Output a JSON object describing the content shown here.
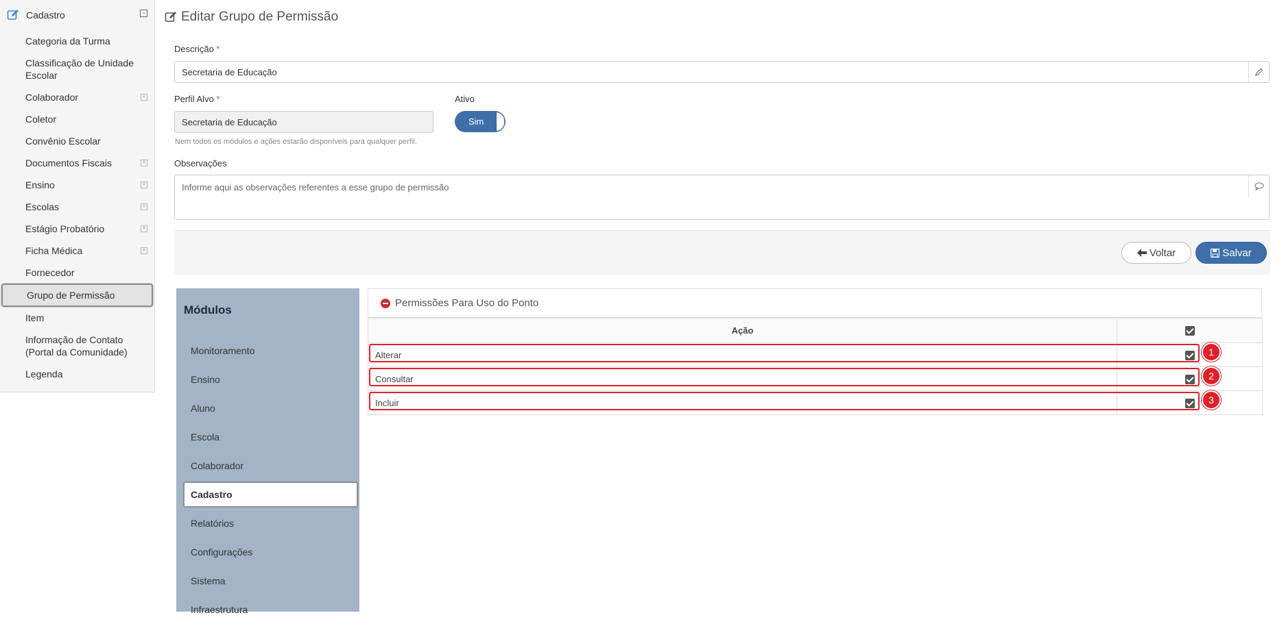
{
  "sidebar": {
    "header": "Cadastro",
    "items": [
      {
        "label": "Categoria da Turma",
        "expandable": false
      },
      {
        "label": "Classificação de Unidade Escolar",
        "expandable": false
      },
      {
        "label": "Colaborador",
        "expandable": true
      },
      {
        "label": "Coletor",
        "expandable": false
      },
      {
        "label": "Convênio Escolar",
        "expandable": false
      },
      {
        "label": "Documentos Fiscais",
        "expandable": true
      },
      {
        "label": "Ensino",
        "expandable": true
      },
      {
        "label": "Escolas",
        "expandable": true
      },
      {
        "label": "Estágio Probatório",
        "expandable": true
      },
      {
        "label": "Ficha Médica",
        "expandable": true
      },
      {
        "label": "Fornecedor",
        "expandable": false
      },
      {
        "label": "Grupo de Permissão",
        "expandable": false,
        "active": true
      },
      {
        "label": "Item",
        "expandable": false
      },
      {
        "label": "Informação de Contato (Portal da Comunidade)",
        "expandable": false
      },
      {
        "label": "Legenda",
        "expandable": false
      }
    ]
  },
  "page": {
    "title": "Editar Grupo de Permissão"
  },
  "form": {
    "descricao_label": "Descrição",
    "descricao_value": "Secretaria de Educação",
    "perfil_label": "Perfil Alvo",
    "perfil_value": "Secretaria de Educação",
    "perfil_hint": "Nem todos os módulos e ações estarão disponíveis para qualquer perfil.",
    "ativo_label": "Ativo",
    "ativo_value": "Sim",
    "obs_label": "Observações",
    "obs_placeholder": "Informe aqui as observações referentes a esse grupo de permissão",
    "required_mark": "*"
  },
  "actions": {
    "back_label": "Voltar",
    "save_label": "Salvar"
  },
  "modules": {
    "title": "Módulos",
    "items": [
      "Monitoramento",
      "Ensino",
      "Aluno",
      "Escola",
      "Colaborador",
      "Cadastro",
      "Relatórios",
      "Configurações",
      "Sistema",
      "Infraestrutura"
    ],
    "active": "Cadastro"
  },
  "permissions": {
    "title": "Permissões Para Uso do Ponto",
    "column_action": "Ação",
    "rows": [
      {
        "label": "Alterar",
        "checked": true,
        "badge": "1"
      },
      {
        "label": "Consultar",
        "checked": true,
        "badge": "2"
      },
      {
        "label": "Incluir",
        "checked": true,
        "badge": "3"
      }
    ]
  },
  "colors": {
    "primary": "#3e6fa8",
    "modules_bg": "#a3b4c6",
    "highlight": "#e0202a"
  }
}
